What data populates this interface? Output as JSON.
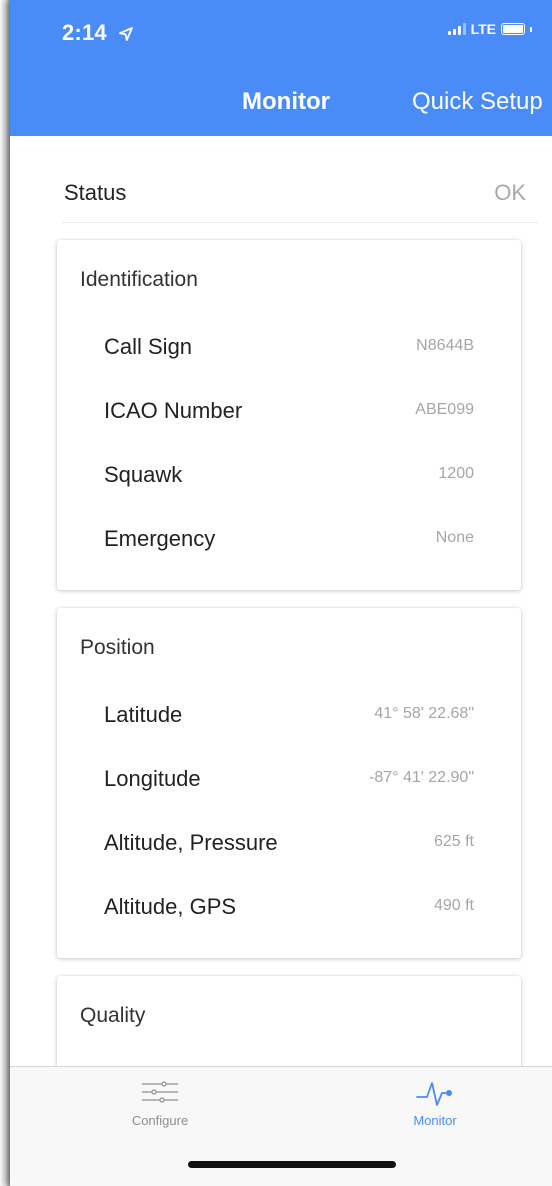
{
  "status_bar": {
    "time": "2:14",
    "network": "LTE"
  },
  "nav": {
    "title": "Monitor",
    "action": "Quick Setup"
  },
  "status": {
    "label": "Status",
    "value": "OK"
  },
  "identification": {
    "title": "Identification",
    "fields": [
      {
        "label": "Call Sign",
        "value": "N8644B"
      },
      {
        "label": "ICAO Number",
        "value": "ABE099"
      },
      {
        "label": "Squawk",
        "value": "1200"
      },
      {
        "label": "Emergency",
        "value": "None"
      }
    ]
  },
  "position": {
    "title": "Position",
    "fields": [
      {
        "label": "Latitude",
        "value": "41° 58' 22.68\""
      },
      {
        "label": "Longitude",
        "value": "-87° 41' 22.90\""
      },
      {
        "label": "Altitude, Pressure",
        "value": "625 ft"
      },
      {
        "label": "Altitude, GPS",
        "value": "490 ft"
      }
    ]
  },
  "quality": {
    "title": "Quality"
  },
  "tabbar": {
    "items": [
      {
        "label": "Configure",
        "icon": "sliders-icon",
        "selected": false
      },
      {
        "label": "Monitor",
        "icon": "pulse-icon",
        "selected": true
      }
    ]
  },
  "colors": {
    "accent": "#4a8cf7",
    "inactive_tab": "#8e8e93",
    "muted_text": "#a6a6a6"
  }
}
